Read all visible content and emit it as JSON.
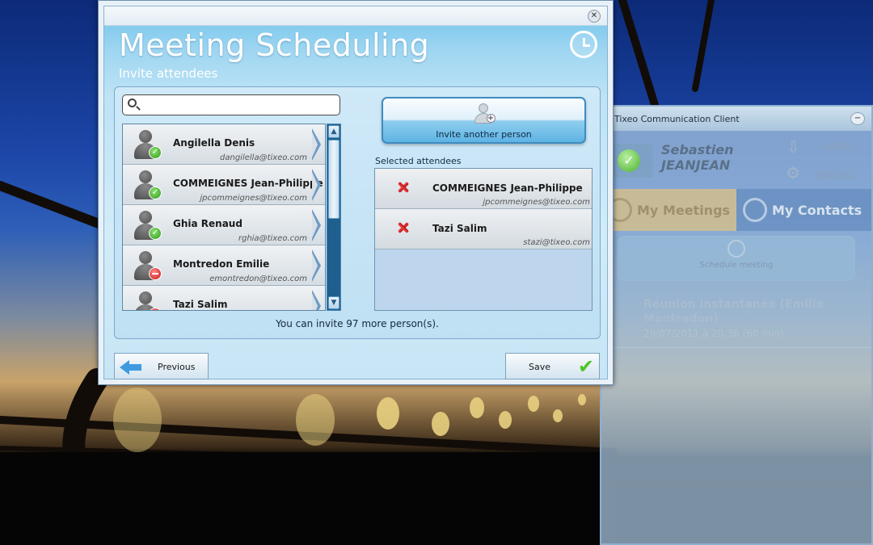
{
  "dialog": {
    "title": "Meeting Scheduling",
    "subtitle": "Invite attendees",
    "search": {
      "value": "",
      "placeholder": ""
    },
    "contacts": [
      {
        "name": "Angilella Denis",
        "email": "dangilella@tixeo.com",
        "status": "available"
      },
      {
        "name": "COMMEIGNES Jean-Philippe",
        "email": "jpcommeignes@tixeo.com",
        "status": "available"
      },
      {
        "name": "Ghia Renaud",
        "email": "rghia@tixeo.com",
        "status": "available"
      },
      {
        "name": "Montredon Emilie",
        "email": "emontredon@tixeo.com",
        "status": "busy"
      },
      {
        "name": "Tazi Salim",
        "email": "",
        "status": "busy"
      }
    ],
    "invite_button_label": "Invite another person",
    "selected_heading": "Selected attendees",
    "selected": [
      {
        "name": "COMMEIGNES Jean-Philippe",
        "email": "jpcommeignes@tixeo.com"
      },
      {
        "name": "Tazi Salim",
        "email": "stazi@tixeo.com"
      }
    ],
    "invite_count_text": "You can invite 97 more person(s).",
    "previous_label": "Previous",
    "save_label": "Save"
  },
  "background_app": {
    "title": "Tixeo Communication Client",
    "user_first": "Sebastien",
    "user_last": "JEANJEAN",
    "logout_label": "Logout",
    "settings_label": "Settings",
    "tab_meetings": "My Meetings",
    "tab_contacts": "My Contacts",
    "schedule_label": "Schedule meeting",
    "meeting_title": "Réunion instantanée (Emilie Montredon)",
    "meeting_date": "29/07/2011 à 20:36 (60 min)"
  },
  "colors": {
    "accent": "#3f8cc0",
    "available": "#2f9a1a",
    "busy": "#c81818",
    "remove": "#e03030"
  }
}
